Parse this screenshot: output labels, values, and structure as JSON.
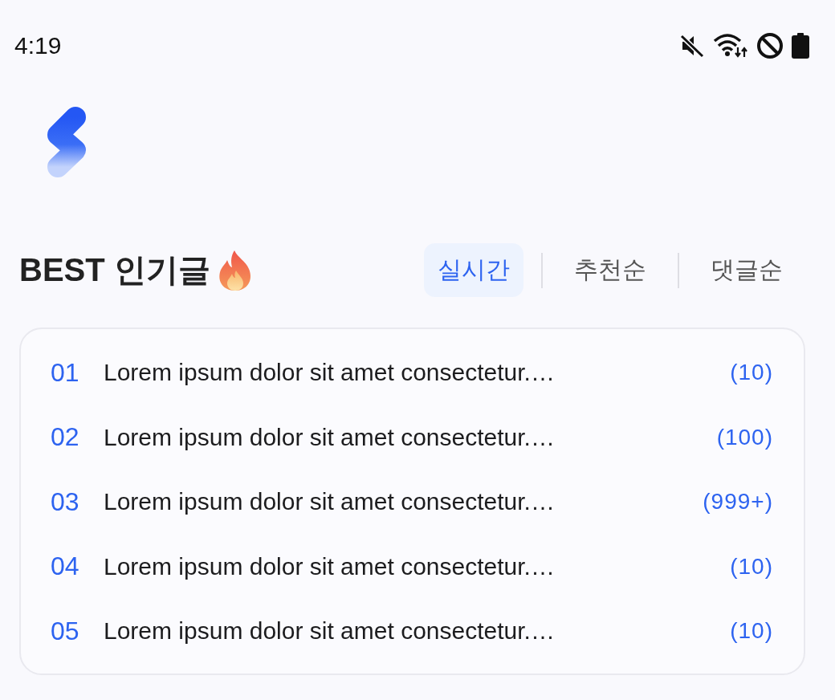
{
  "status_bar": {
    "time": "4:19"
  },
  "section": {
    "title": "BEST 인기글"
  },
  "tabs": [
    {
      "label": "실시간",
      "selected": true
    },
    {
      "label": "추천순",
      "selected": false
    },
    {
      "label": "댓글순",
      "selected": false
    }
  ],
  "posts": [
    {
      "rank": "01",
      "title": "Lorem ipsum dolor sit amet consectetur.…",
      "count": "(10)"
    },
    {
      "rank": "02",
      "title": "Lorem ipsum dolor sit amet consectetur.…",
      "count": "(100)"
    },
    {
      "rank": "03",
      "title": "Lorem ipsum dolor sit amet consectetur.…",
      "count": "(999+)"
    },
    {
      "rank": "04",
      "title": "Lorem ipsum dolor sit amet consectetur.…",
      "count": "(10)"
    },
    {
      "rank": "05",
      "title": "Lorem ipsum dolor sit amet consectetur.…",
      "count": "(10)"
    }
  ]
}
